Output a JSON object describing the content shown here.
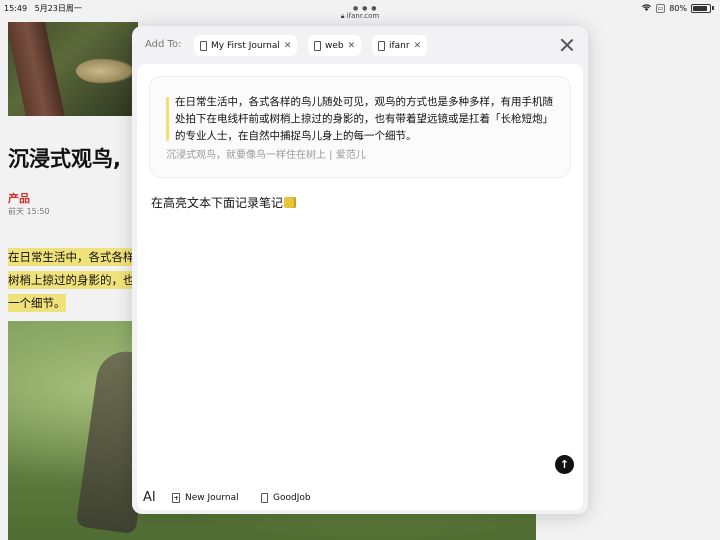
{
  "status_bar": {
    "time": "15:49",
    "date": "5月23日周一",
    "url": "ifanr.com",
    "battery": "80%"
  },
  "article": {
    "title": "沉浸式观鸟,",
    "category": "产品",
    "time": "前天 15:50",
    "body_lines": [
      "在日常生活中，各式各样",
      "树梢上掠过的身影的，也",
      "一个细节。"
    ]
  },
  "panel": {
    "add_to_label": "Add To:",
    "tags": [
      {
        "label": "My First Journal"
      },
      {
        "label": "web"
      },
      {
        "label": "ifanr"
      }
    ],
    "quote": {
      "text": "在日常生活中，各式各样的鸟儿随处可见，观鸟的方式也是多种多样，有用手机随处拍下在电线杆前或树梢上掠过的身影的，也有带着望远镜或是扛着「长枪短炮」的专业人士，在自然中捕捉鸟儿身上的每一个细节。",
      "source": "沉浸式观鸟，就要像鸟一样住在树上 | 爱范儿"
    },
    "note": "在高亮文本下面记录笔记",
    "send_glyph": "↑",
    "text_style_glyph": "AI",
    "footer_journals": [
      {
        "label": "New Journal"
      },
      {
        "label": "GoodJob"
      }
    ]
  },
  "colors": {
    "highlight": "#efe27a",
    "category_red": "#d9302c",
    "quote_bar": "#f4e06a"
  }
}
